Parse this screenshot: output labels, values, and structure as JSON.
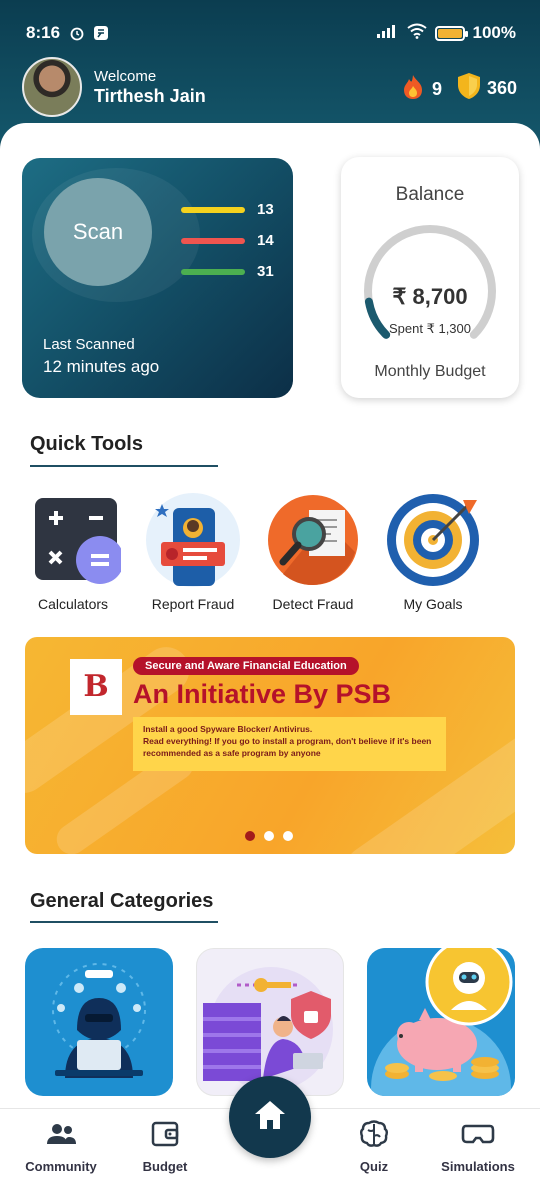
{
  "status_bar": {
    "time": "8:16",
    "battery": "100%",
    "battery_level": 1.0
  },
  "header": {
    "welcome": "Welcome",
    "user_name": "Tirthesh Jain",
    "streak_count": "9",
    "coin_count": "360"
  },
  "scan_card": {
    "scan_label": "Scan",
    "metrics": [
      {
        "value": "13",
        "color": "#f4d21e"
      },
      {
        "value": "14",
        "color": "#f0554f"
      },
      {
        "value": "31",
        "color": "#4caf50"
      }
    ],
    "last_scanned_label": "Last Scanned",
    "last_scanned_value": "12 minutes ago"
  },
  "balance_card": {
    "title": "Balance",
    "amount": "₹ 8,700",
    "spent": "Spent ₹ 1,300",
    "footer": "Monthly Budget",
    "spent_fraction": 0.13
  },
  "quick_tools": {
    "heading": "Quick Tools",
    "items": [
      {
        "label": "Calculators",
        "icon": "calculator-icon"
      },
      {
        "label": "Report Fraud",
        "icon": "report-fraud-icon"
      },
      {
        "label": "Detect Fraud",
        "icon": "detect-fraud-icon"
      },
      {
        "label": "My Goals",
        "icon": "target-icon"
      }
    ]
  },
  "banner": {
    "logo_mark": "B",
    "tagline": "Secure and Aware Financial Education",
    "title": "An Initiative By PSB",
    "line1": "Install a good Spyware Blocker/ Antivirus.",
    "line2": "Read everything! If you go to install a program, don't believe if it's been recommended as a safe program by anyone",
    "active_slide": 1,
    "slide_count": 3
  },
  "general_categories": {
    "heading": "General Categories"
  },
  "bottom_nav": {
    "items": [
      "Community",
      "Budget",
      "Quiz",
      "Simulations"
    ]
  },
  "colors": {
    "header": "#0b3d50",
    "accent_dark": "#12384d",
    "banner_orange": "#f6b733",
    "banner_red": "#b5122a"
  }
}
